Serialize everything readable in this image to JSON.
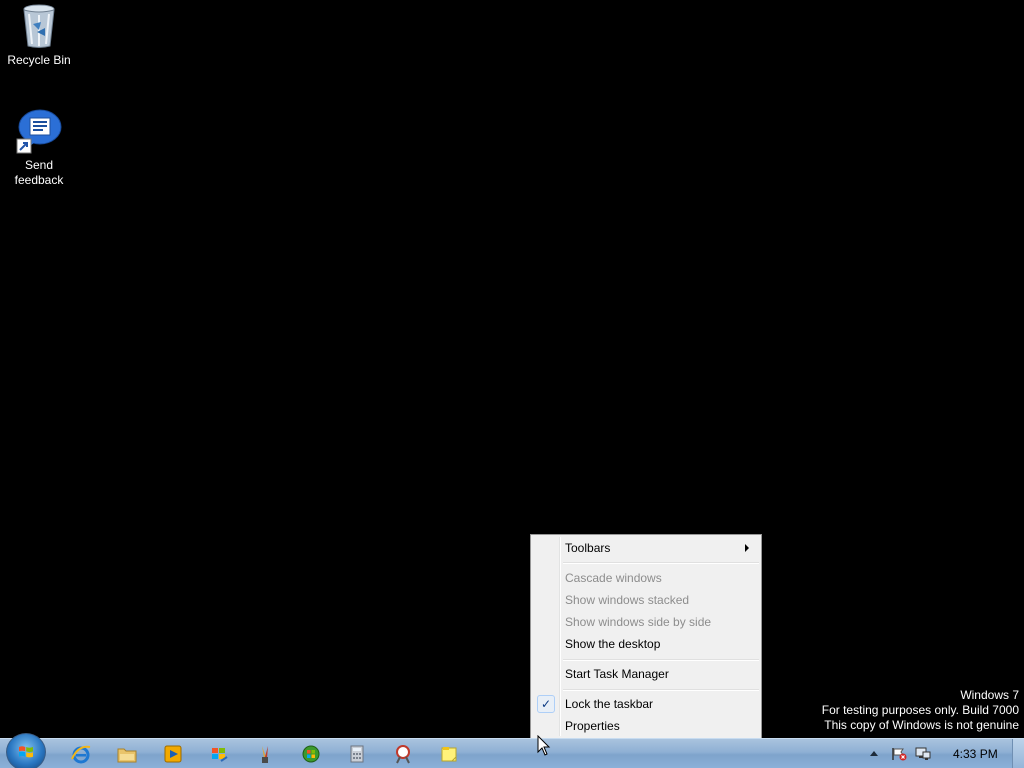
{
  "desktop": {
    "icons": [
      {
        "label": "Recycle Bin",
        "icon": "recycle-bin-icon"
      },
      {
        "label": "Send feedback",
        "icon": "send-feedback-icon"
      }
    ]
  },
  "context_menu": {
    "items": [
      {
        "label": "Toolbars",
        "enabled": true,
        "submenu": true
      },
      {
        "label": "Cascade windows",
        "enabled": false
      },
      {
        "label": "Show windows stacked",
        "enabled": false
      },
      {
        "label": "Show windows side by side",
        "enabled": false
      },
      {
        "label": "Show the desktop",
        "enabled": true
      },
      {
        "label": "Start Task Manager",
        "enabled": true
      },
      {
        "label": "Lock the taskbar",
        "enabled": true,
        "checked": true
      },
      {
        "label": "Properties",
        "enabled": true
      }
    ],
    "check_glyph": "✓"
  },
  "watermark": {
    "line1": "Windows  7",
    "line2": "For testing purposes only. Build 7000",
    "line3": "This copy of Windows is not genuine"
  },
  "taskbar": {
    "start_icon": "windows-logo-icon",
    "pinned": [
      {
        "name": "internet-explorer-icon"
      },
      {
        "name": "windows-explorer-icon"
      },
      {
        "name": "media-player-icon"
      },
      {
        "name": "windows-update-icon"
      },
      {
        "name": "paint-icon"
      },
      {
        "name": "media-center-icon"
      },
      {
        "name": "calculator-icon"
      },
      {
        "name": "snipping-tool-icon"
      },
      {
        "name": "sticky-notes-icon"
      }
    ],
    "clock": "4:33 PM"
  },
  "colors": {
    "desktop_bg": "#000000",
    "menu_bg": "#f0f0f0",
    "menu_disabled": "#8d8d8d",
    "taskbar": "#8fb0d4"
  }
}
